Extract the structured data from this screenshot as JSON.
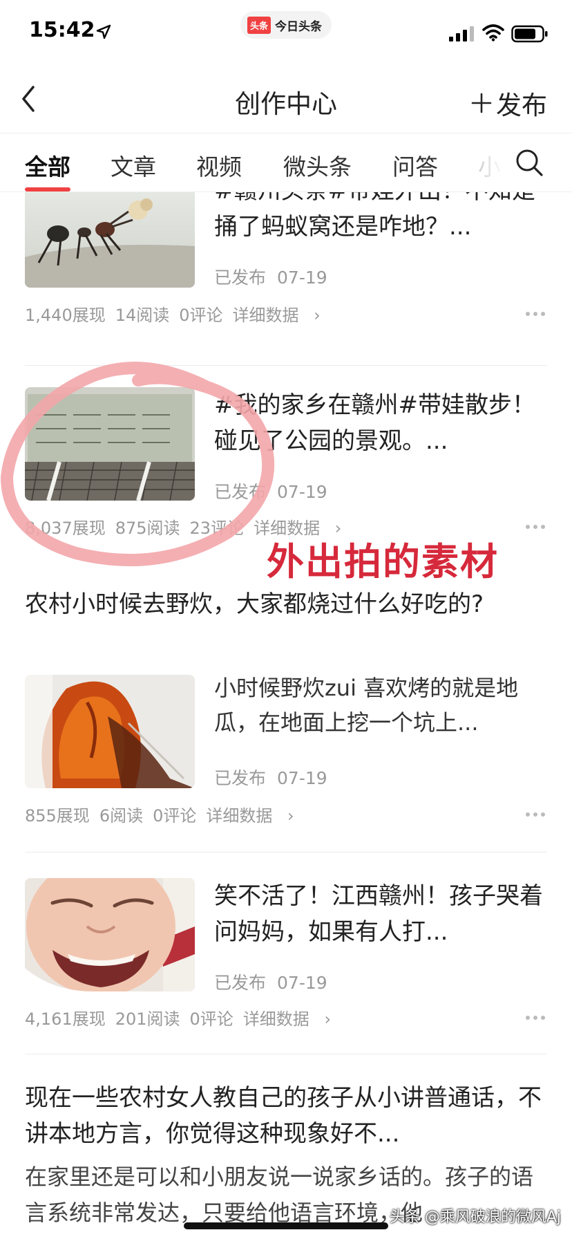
{
  "status_bar": {
    "time": "15:42",
    "app_badge": "头条",
    "app_name": "今日头条"
  },
  "nav": {
    "title": "创作中心",
    "publish_label": "发布"
  },
  "tabs": [
    {
      "label": "全部",
      "active": true
    },
    {
      "label": "文章",
      "active": false
    },
    {
      "label": "视频",
      "active": false
    },
    {
      "label": "微头条",
      "active": false
    },
    {
      "label": "问答",
      "active": false
    },
    {
      "label": "小",
      "active": false
    }
  ],
  "posts": [
    {
      "title": "#赣州头条#带娃外出！不知是捅了蚂蚁窝还是咋地？...",
      "status": "已发布",
      "date": "07-19",
      "impressions": "1,440展现",
      "reads": "14阅读",
      "comments": "0评论",
      "detail_link": "详细数据",
      "thumb_icon": "ant-photo"
    },
    {
      "title": "#我的家乡在赣州#带娃散步！碰见了公园的景观。...",
      "status": "已发布",
      "date": "07-19",
      "impressions": "8,037展现",
      "reads": "875阅读",
      "comments": "23评论",
      "detail_link": "详细数据",
      "thumb_icon": "park-sign-photo"
    },
    {
      "title": "农村小时候去野炊，大家都烧过什么好吃的?",
      "excerpt": "小时候野炊zui 喜欢烤的就是地瓜，在地面上挖一个坑上...",
      "status": "已发布",
      "date": "07-19",
      "impressions": "855展现",
      "reads": "6阅读",
      "comments": "0评论",
      "detail_link": "详细数据",
      "thumb_icon": "roasted-sweet-potato-photo"
    },
    {
      "title": "笑不活了！江西赣州！孩子哭着问妈妈，如果有人打...",
      "status": "已发布",
      "date": "07-19",
      "impressions": "4,161展现",
      "reads": "201阅读",
      "comments": "0评论",
      "detail_link": "详细数据",
      "thumb_icon": "crying-child-photo"
    },
    {
      "title": "现在一些农村女人教自己的孩子从小讲普通话，不讲本地方言，你觉得这种现象好不...",
      "excerpt": "在家里还是可以和小朋友说一说家乡话的。孩子的语言系统非常发达，只要给他语言环境，他"
    }
  ],
  "annotation": "外出拍的素材",
  "watermark": "头条 @乘风破浪的微风Aj",
  "colors": {
    "accent": "#f04142",
    "annotation": "#d6293b",
    "hand_circle": "#f3a6aa"
  }
}
